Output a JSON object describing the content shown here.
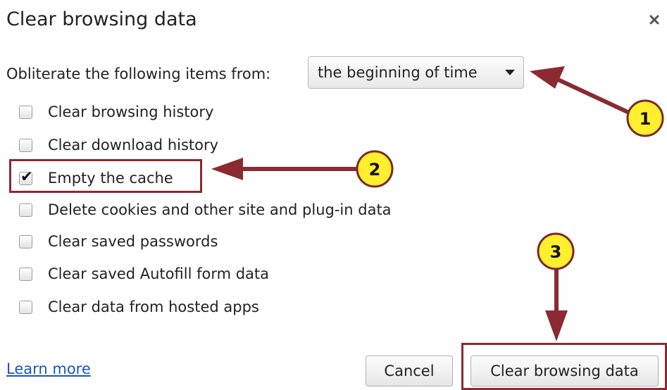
{
  "dialog": {
    "title": "Clear browsing data",
    "close_symbol": "×"
  },
  "range": {
    "label": "Obliterate the following items from:",
    "selected": "the beginning of time"
  },
  "options": [
    {
      "label": "Clear browsing history",
      "checked": false
    },
    {
      "label": "Clear download history",
      "checked": false
    },
    {
      "label": "Empty the cache",
      "checked": true
    },
    {
      "label": "Delete cookies and other site and plug-in data",
      "checked": false
    },
    {
      "label": "Clear saved passwords",
      "checked": false
    },
    {
      "label": "Clear saved Autofill form data",
      "checked": false
    },
    {
      "label": "Clear data from hosted apps",
      "checked": false
    }
  ],
  "check_symbol": "✔",
  "footer": {
    "learn_more": "Learn more",
    "cancel": "Cancel",
    "confirm": "Clear browsing data"
  },
  "callouts": {
    "one": "1",
    "two": "2",
    "three": "3"
  },
  "colors": {
    "annotation_red": "#8b2a32",
    "callout_fill": "#ffef2e",
    "link_blue": "#1a55c4"
  }
}
